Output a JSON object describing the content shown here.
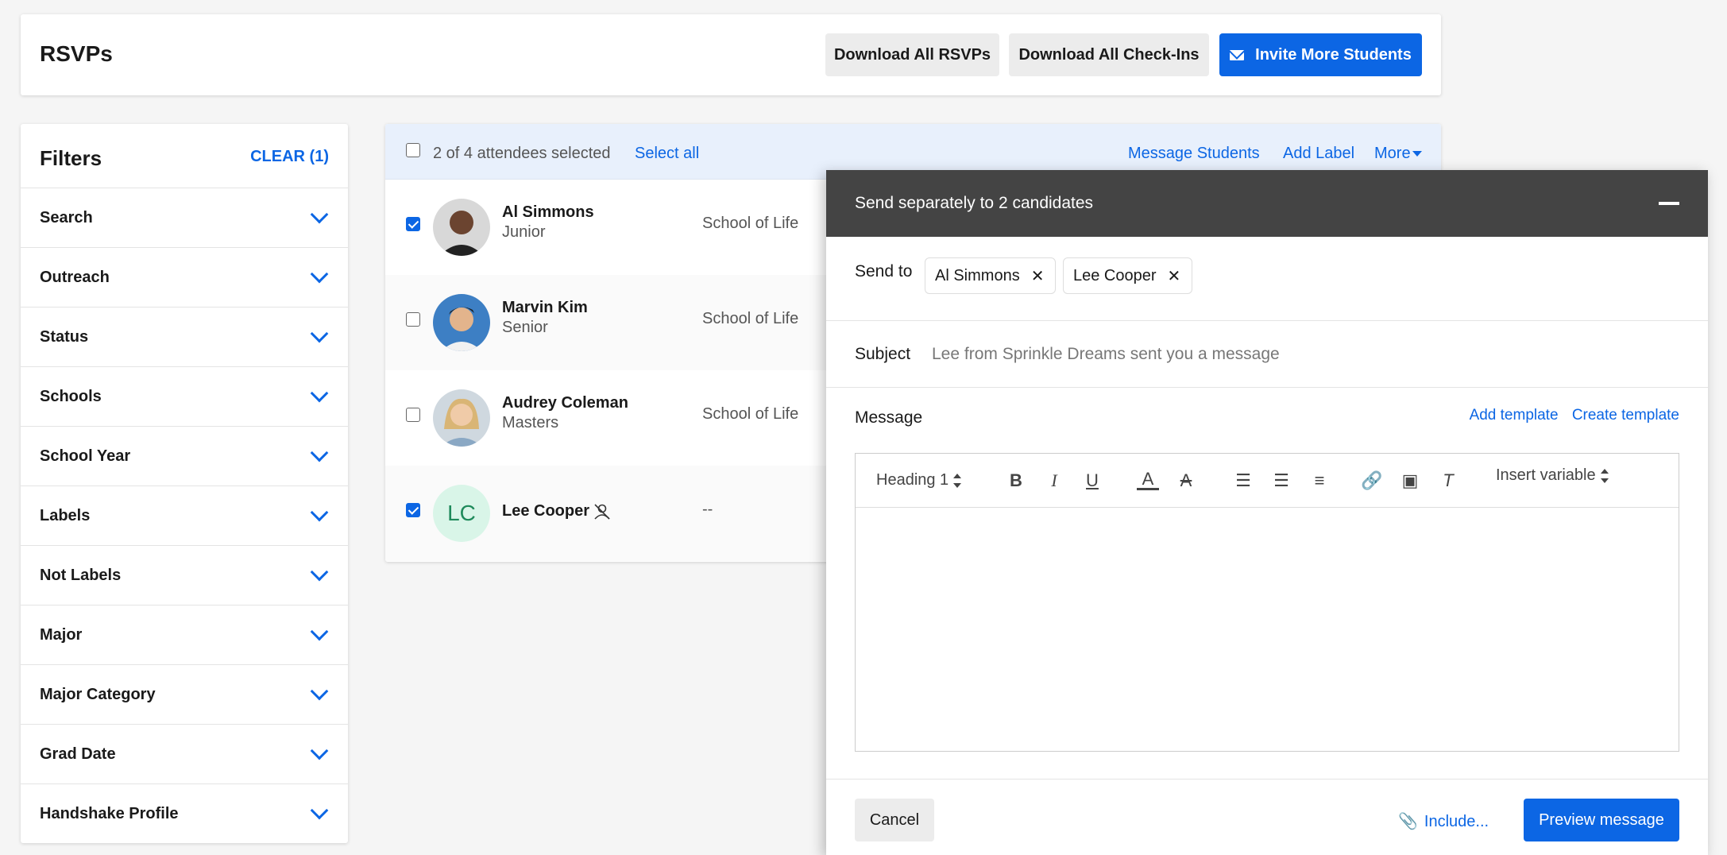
{
  "header": {
    "title": "RSVPs",
    "download_rsvps": "Download All RSVPs",
    "download_checkins": "Download All Check-Ins",
    "invite": "Invite More Students"
  },
  "filters": {
    "title": "Filters",
    "clear": "CLEAR (1)",
    "items": [
      "Search",
      "Outreach",
      "Status",
      "Schools",
      "School Year",
      "Labels",
      "Not Labels",
      "Major",
      "Major Category",
      "Grad Date",
      "Handshake Profile"
    ]
  },
  "table": {
    "selected_text": "2 of 4 attendees selected",
    "select_all": "Select all",
    "message_students": "Message Students",
    "add_label": "Add Label",
    "more": "More",
    "rows": [
      {
        "name": "Al Simmons",
        "year": "Junior",
        "school": "School of Life",
        "checked": true
      },
      {
        "name": "Marvin Kim",
        "year": "Senior",
        "school": "School of Life",
        "checked": false
      },
      {
        "name": "Audrey Coleman",
        "year": "Masters",
        "school": "School of Life",
        "checked": false
      },
      {
        "name": "Lee Cooper",
        "initials": "LC",
        "year": "",
        "school": "--",
        "checked": true
      }
    ]
  },
  "composer": {
    "title": "Send separately to 2 candidates",
    "send_to_label": "Send to",
    "recipients": [
      "Al Simmons",
      "Lee Cooper"
    ],
    "subject_label": "Subject",
    "subject_value": "Lee from Sprinkle Dreams sent you a message",
    "message_label": "Message",
    "add_template": "Add template",
    "create_template": "Create template",
    "heading_select": "Heading 1",
    "insert_variable": "Insert variable",
    "cancel": "Cancel",
    "include": "Include...",
    "preview": "Preview message"
  },
  "colors": {
    "accent": "#0c66e4",
    "composer_header": "#444444"
  }
}
